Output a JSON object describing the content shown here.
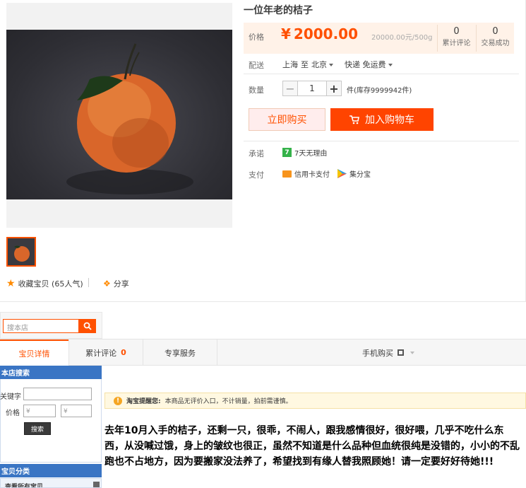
{
  "product": {
    "title": "一位年老的桔子",
    "price_label": "价格",
    "currency_symbol": "¥",
    "price": "2000.00",
    "price_ref": "20000.00元/500g",
    "stats": [
      {
        "value": "0",
        "label": "累计评论"
      },
      {
        "value": "0",
        "label": "交易成功"
      }
    ],
    "delivery_label": "配送",
    "delivery_from": "上海",
    "delivery_to_sym": "至",
    "delivery_city": "北京",
    "delivery_method": "快递 免运费",
    "qty_label": "数量",
    "qty_minus": "−",
    "qty_value": "1",
    "qty_plus": "+",
    "qty_unit": "件(库存9999942件)",
    "buy_now": "立即购买",
    "add_to_cart": "加入购物车",
    "promise_label": "承诺",
    "promise_badge": "7",
    "promise_text": "7天无理由",
    "pay_label": "支付",
    "pay_methods": [
      "信用卡支付",
      "集分宝"
    ],
    "favorite_text": "收藏宝贝 (65人气)",
    "share_text": "分享"
  },
  "shop": {
    "search_placeholder": "搜本店",
    "tabs": [
      "宝贝详情",
      "累计评论",
      "0",
      "专享服务",
      "手机购买"
    ],
    "side_search_title": "本店搜索",
    "keyword_label": "关键字",
    "price_label": "价格",
    "price_min_placeholder": "¥",
    "price_max_placeholder": "¥",
    "search_button": "搜索",
    "category_title": "宝贝分类",
    "category_partial": "查看所有宝贝"
  },
  "notice": {
    "bold": "淘宝提醒您:",
    "text": "本商品无评价入口，不计销量，拍前需谨慎。"
  },
  "description": "去年10月入手的桔子，还剩一只，很乖，不闹人，跟我感情很好，很好喂，几乎不吃什么东西，从没喊过饿，身上的皱纹也很正，虽然不知道是什么品种但血统很纯是没错的，小小的不乱跑也不占地方，因为要搬家没法养了，希望找到有缘人替我照顾她！请一定要好好待她!!!",
  "colors": {
    "accent": "#ff5000",
    "blue": "#3a75c4"
  }
}
